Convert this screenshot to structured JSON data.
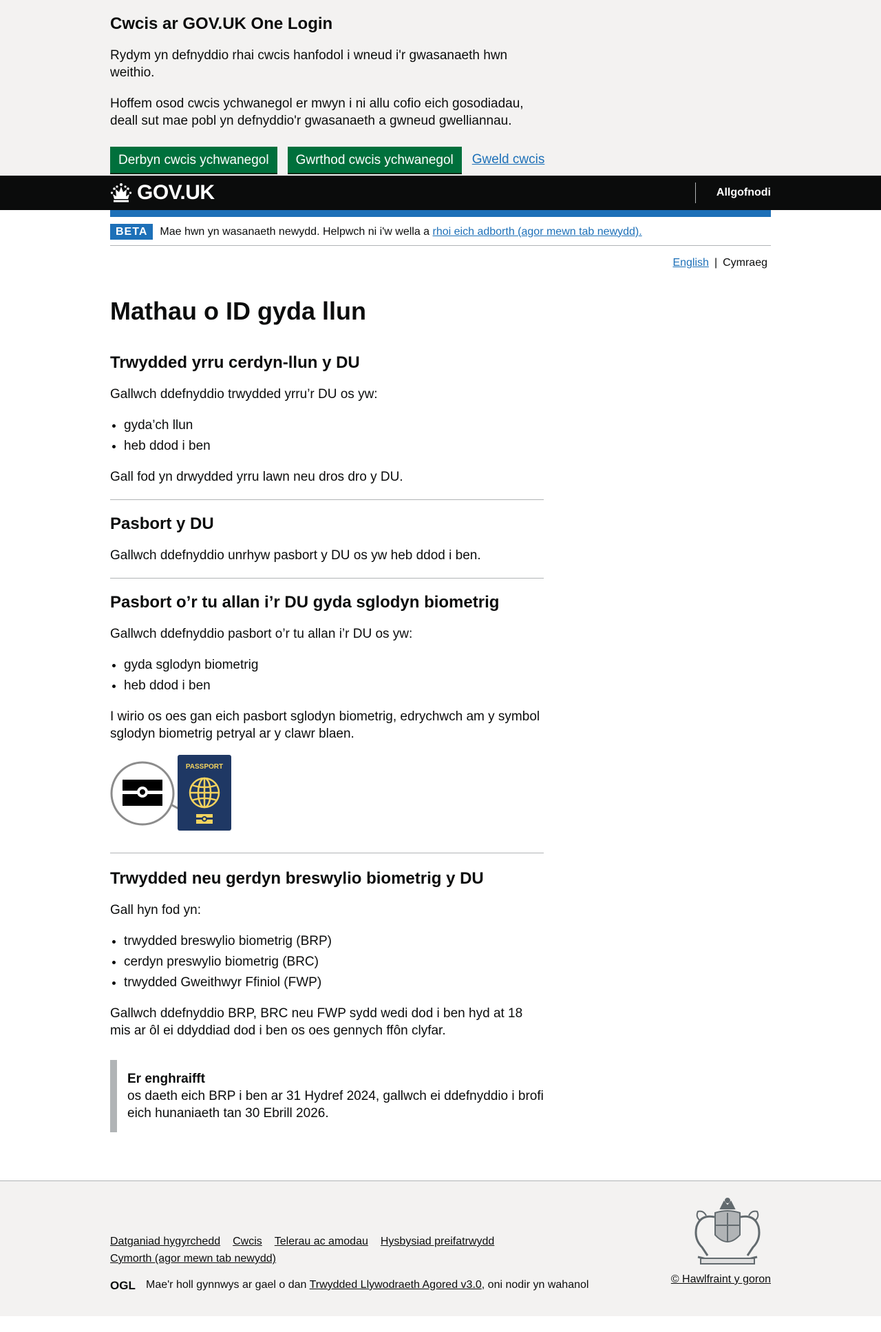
{
  "cookie_banner": {
    "heading": "Cwcis ar GOV.UK One Login",
    "p1": "Rydym yn defnyddio rhai cwcis hanfodol i wneud i'r gwasanaeth hwn weithio.",
    "p2": "Hoffem osod cwcis ychwanegol er mwyn i ni allu cofio eich gosodiadau, deall sut mae pobl yn defnyddio'r gwasanaeth a gwneud gwelliannau.",
    "accept_label": "Derbyn cwcis ychwanegol",
    "reject_label": "Gwrthod cwcis ychwanegol",
    "view_label": "Gweld cwcis"
  },
  "header": {
    "logo_text": "GOV.UK",
    "signout_label": "Allgofnodi"
  },
  "phase_banner": {
    "tag": "BETA",
    "text": "Mae hwn yn wasanaeth newydd. Helpwch ni i'w wella a ",
    "link": "rhoi eich adborth (agor mewn tab newydd)."
  },
  "language": {
    "english": "English",
    "separator": "|",
    "welsh": "Cymraeg"
  },
  "main": {
    "title": "Mathau o ID gyda llun",
    "sections": [
      {
        "heading": "Trwydded yrru cerdyn-llun y DU",
        "intro": "Gallwch ddefnyddio trwydded yrru’r DU os yw:",
        "bullets": [
          "gyda’ch llun",
          "heb ddod i ben"
        ],
        "outro": "Gall fod yn drwydded yrru lawn neu dros dro y DU."
      },
      {
        "heading": "Pasbort y DU",
        "intro": "Gallwch ddefnyddio unrhyw pasbort y DU os yw heb ddod i ben."
      },
      {
        "heading": "Pasbort o’r tu allan i’r DU gyda sglodyn biometrig",
        "intro": "Gallwch ddefnyddio pasbort o’r tu allan i’r DU os yw:",
        "bullets": [
          "gyda sglodyn biometrig",
          "heb ddod i ben"
        ],
        "outro": "I wirio os oes gan eich pasbort sglodyn biometrig, edrychwch am y symbol sglodyn biometrig petryal ar y clawr blaen.",
        "passport_label": "PASSPORT"
      },
      {
        "heading": "Trwydded neu gerdyn breswylio biometrig y DU",
        "intro": "Gall hyn fod yn:",
        "bullets": [
          "trwydded breswylio biometrig (BRP)",
          "cerdyn preswylio biometrig (BRC)",
          "trwydded Gweithwyr Ffiniol (FWP)"
        ],
        "outro": "Gallwch ddefnyddio BRP, BRC neu FWP sydd wedi dod i ben hyd at 18 mis ar ôl ei ddyddiad dod i ben os oes gennych ffôn clyfar."
      }
    ],
    "inset": {
      "title": "Er enghraifft",
      "text": "os daeth eich BRP i ben ar 31 Hydref 2024, gallwch ei ddefnyddio i brofi eich hunaniaeth tan 30 Ebrill 2026."
    }
  },
  "footer": {
    "links": [
      "Datganiad hygyrchedd",
      "Cwcis",
      "Telerau ac amodau",
      "Hysbysiad preifatrwydd",
      "Cymorth (agor mewn tab newydd)"
    ],
    "licence_prefix": "Mae'r holl gynnwys ar gael o dan ",
    "licence_link": "Trwydded Llywodraeth Agored v3.0",
    "licence_suffix": ", oni nodir yn wahanol",
    "ogl_text": "OGL",
    "copyright": "© Hawlfraint y goron"
  },
  "colors": {
    "primary_button": "#00703c",
    "link": "#1d70b8",
    "header": "#0b0c0c",
    "passport_cover": "#1f3864",
    "passport_gold": "#f4d35e"
  }
}
